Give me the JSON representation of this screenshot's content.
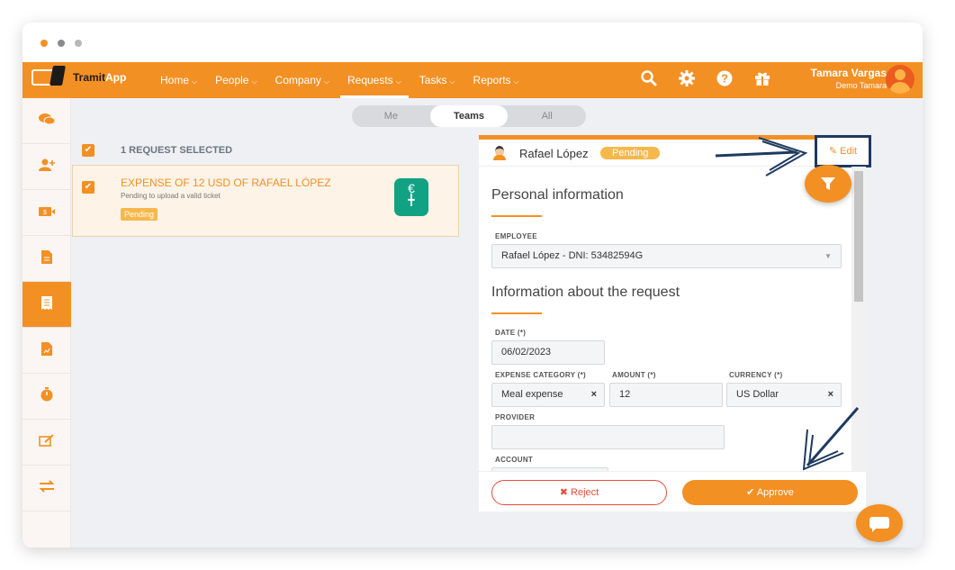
{
  "window": {
    "dots": [
      "#f39024",
      "#8a8a8a",
      "#b8b8b8"
    ]
  },
  "brand": {
    "name_part1": "Tramit",
    "name_part2": "App",
    "accent": "#f39024"
  },
  "nav": {
    "items": [
      {
        "label": "Home"
      },
      {
        "label": "People"
      },
      {
        "label": "Company"
      },
      {
        "label": "Requests"
      },
      {
        "label": "Tasks"
      },
      {
        "label": "Reports"
      }
    ],
    "active": "Requests",
    "icons": [
      "search-icon",
      "gear-icon",
      "help-icon",
      "gift-icon"
    ]
  },
  "user": {
    "name": "Tamara Vargas",
    "company": "Demo Tamara"
  },
  "sidebar": {
    "items": [
      "chat-icon",
      "add-user-icon",
      "payroll-icon",
      "document-icon",
      "receipt-icon",
      "report-icon",
      "timer-icon",
      "sign-icon",
      "transfer-icon"
    ],
    "active_index": 4
  },
  "filter_tabs": {
    "options": [
      "Me",
      "Teams",
      "All"
    ],
    "active": "Teams"
  },
  "request_list": {
    "header": "1 REQUEST SELECTED",
    "items": [
      {
        "title": "EXPENSE OF 12 USD OF RAFAEL LÓPEZ",
        "subtitle": "Pending to upload a valid ticket",
        "status": "Pending",
        "icon": "euro-hand-icon"
      }
    ]
  },
  "detail": {
    "person": "Rafael López",
    "status": "Pending",
    "edit_label": "Edit",
    "personal_section": "Personal information",
    "employee_label": "EMPLOYEE",
    "employee_value": "Rafael López - DNI: 53482594G",
    "request_section": "Information about the request",
    "date_label": "DATE (*)",
    "date_value": "06/02/2023",
    "category_label": "EXPENSE CATEGORY (*)",
    "category_value": "Meal expense",
    "amount_label": "AMOUNT (*)",
    "amount_value": "12",
    "currency_label": "CURRENCY (*)",
    "currency_value": "US Dollar",
    "provider_label": "PROVIDER",
    "provider_value": "",
    "account_label": "ACCOUNT",
    "account_value": ""
  },
  "actions": {
    "reject": "Reject",
    "approve": "Approve"
  },
  "colors": {
    "accent": "#f39024",
    "pending": "#f6b84a",
    "reject": "#e74c3c",
    "annotation": "#1e3a5f"
  }
}
